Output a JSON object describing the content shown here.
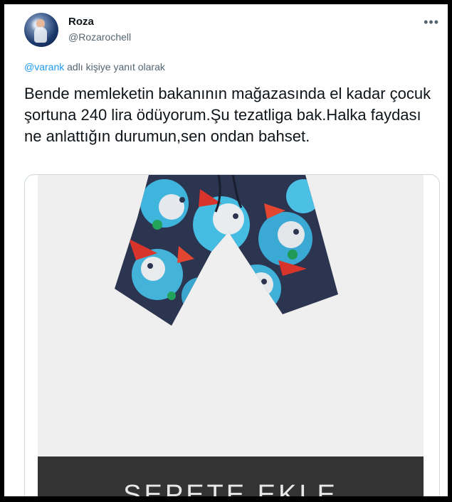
{
  "user": {
    "name": "Roza",
    "handle": "@Rozarochell"
  },
  "more_icon": "more-horizontal-icon",
  "reply_context": {
    "mention": "@varank",
    "suffix": " adlı kişiye yanıt olarak"
  },
  "tweet": {
    "text": "Bende memleketin bakanının mağazasında el kadar çocuk şortuna 240 lira ödüyorum.Şu tezatliga bak.Halka faydası ne anlattığın durumun,sen ondan bahset."
  },
  "media": {
    "product": "patterned-kids-shorts-image",
    "button_label": "SEPETE EKLE"
  },
  "colors": {
    "link": "#1d9bf0",
    "secondary_text": "#536471",
    "button_bg": "#333333"
  }
}
